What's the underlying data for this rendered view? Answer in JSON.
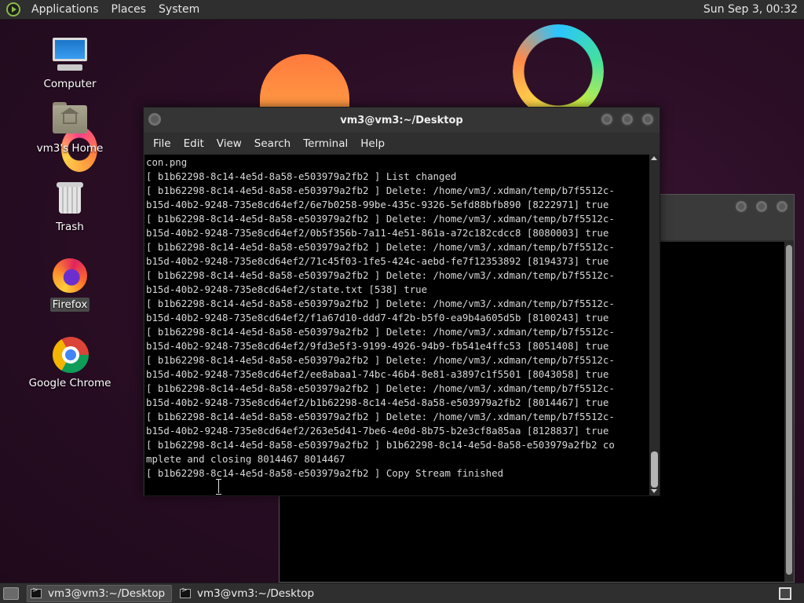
{
  "top_panel": {
    "menus": [
      "Applications",
      "Places",
      "System"
    ],
    "clock": "Sun Sep  3, 00:32"
  },
  "desktop_icons": {
    "computer": "Computer",
    "home": "vm3's Home",
    "trash": "Trash",
    "firefox": "Firefox",
    "chrome": "Google Chrome"
  },
  "terminal": {
    "title": "vm3@vm3:~/Desktop",
    "menu": [
      "File",
      "Edit",
      "View",
      "Search",
      "Terminal",
      "Help"
    ],
    "lines": [
      "con.png",
      "[ b1b62298-8c14-4e5d-8a58-e503979a2fb2 ] List changed",
      "[ b1b62298-8c14-4e5d-8a58-e503979a2fb2 ] Delete: /home/vm3/.xdman/temp/b7f5512c-",
      "b15d-40b2-9248-735e8cd64ef2/6e7b0258-99be-435c-9326-5efd88bfb890 [8222971] true",
      "[ b1b62298-8c14-4e5d-8a58-e503979a2fb2 ] Delete: /home/vm3/.xdman/temp/b7f5512c-",
      "b15d-40b2-9248-735e8cd64ef2/0b5f356b-7a11-4e51-861a-a72c182cdcc8 [8080003] true",
      "[ b1b62298-8c14-4e5d-8a58-e503979a2fb2 ] Delete: /home/vm3/.xdman/temp/b7f5512c-",
      "b15d-40b2-9248-735e8cd64ef2/71c45f03-1fe5-424c-aebd-fe7f12353892 [8194373] true",
      "[ b1b62298-8c14-4e5d-8a58-e503979a2fb2 ] Delete: /home/vm3/.xdman/temp/b7f5512c-",
      "b15d-40b2-9248-735e8cd64ef2/state.txt [538] true",
      "[ b1b62298-8c14-4e5d-8a58-e503979a2fb2 ] Delete: /home/vm3/.xdman/temp/b7f5512c-",
      "b15d-40b2-9248-735e8cd64ef2/f1a67d10-ddd7-4f2b-b5f0-ea9b4a605d5b [8100243] true",
      "[ b1b62298-8c14-4e5d-8a58-e503979a2fb2 ] Delete: /home/vm3/.xdman/temp/b7f5512c-",
      "b15d-40b2-9248-735e8cd64ef2/9fd3e5f3-9199-4926-94b9-fb541e4ffc53 [8051408] true",
      "[ b1b62298-8c14-4e5d-8a58-e503979a2fb2 ] Delete: /home/vm3/.xdman/temp/b7f5512c-",
      "b15d-40b2-9248-735e8cd64ef2/ee8abaa1-74bc-46b4-8e81-a3897c1f5501 [8043058] true",
      "[ b1b62298-8c14-4e5d-8a58-e503979a2fb2 ] Delete: /home/vm3/.xdman/temp/b7f5512c-",
      "b15d-40b2-9248-735e8cd64ef2/b1b62298-8c14-4e5d-8a58-e503979a2fb2 [8014467] true",
      "[ b1b62298-8c14-4e5d-8a58-e503979a2fb2 ] Delete: /home/vm3/.xdman/temp/b7f5512c-",
      "b15d-40b2-9248-735e8cd64ef2/263e5d41-7be6-4e0d-8b75-b2e3cf8a85aa [8128837] true",
      "[ b1b62298-8c14-4e5d-8a58-e503979a2fb2 ] b1b62298-8c14-4e5d-8a58-e503979a2fb2 co",
      "mplete and closing 8014467 8014467",
      "[ b1b62298-8c14-4e5d-8a58-e503979a2fb2 ] Copy Stream finished"
    ]
  },
  "taskbar": {
    "tasks": [
      {
        "label": "vm3@vm3:~/Desktop",
        "active": true
      },
      {
        "label": "vm3@vm3:~/Desktop",
        "active": false
      }
    ]
  },
  "icons": {
    "panel_logo": "mate-logo-icon",
    "computer": "computer-icon",
    "home": "home-folder-icon",
    "trash": "trash-icon",
    "firefox": "firefox-icon",
    "chrome": "chrome-icon",
    "terminal_task": "terminal-icon",
    "show_desktop": "show-desktop-icon",
    "workspace": "workspace-switcher-icon"
  },
  "colors": {
    "panel_bg": "#2f2f2f",
    "terminal_bg": "#000000",
    "terminal_fg": "#d8d8d8",
    "desktop_bg": "#2a0f23"
  }
}
